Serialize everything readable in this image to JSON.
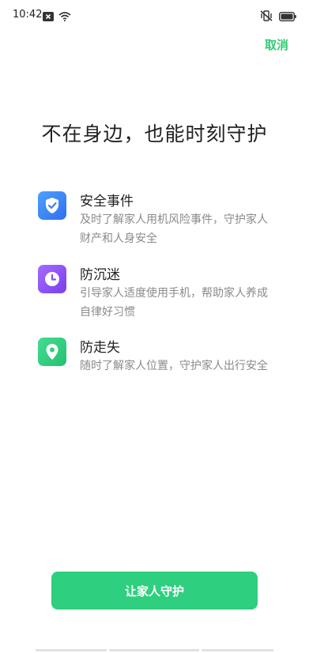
{
  "status_bar": {
    "time": "10:42",
    "icons": [
      "close-box-icon",
      "wifi-icon",
      "vibrate-off-icon",
      "battery-icon"
    ]
  },
  "header": {
    "cancel_label": "取消"
  },
  "main": {
    "title": "不在身边，也能时刻守护",
    "features": [
      {
        "icon": "shield-check-icon",
        "color": "#3d87f5",
        "title": "安全事件",
        "desc": "及时了解家人用机风险事件，守护家人财产和人身安全"
      },
      {
        "icon": "clock-icon",
        "color": "#8a4df5",
        "title": "防沉迷",
        "desc": "引导家人适度使用手机，帮助家人养成自律好习惯"
      },
      {
        "icon": "location-pin-icon",
        "color": "#2ecf7e",
        "title": "防走失",
        "desc": "随时了解家人位置，守护家人出行安全"
      }
    ]
  },
  "footer": {
    "primary_button_label": "让家人守护"
  },
  "colors": {
    "accent": "#2ecf7e",
    "cancel_text": "#2ecc71"
  }
}
